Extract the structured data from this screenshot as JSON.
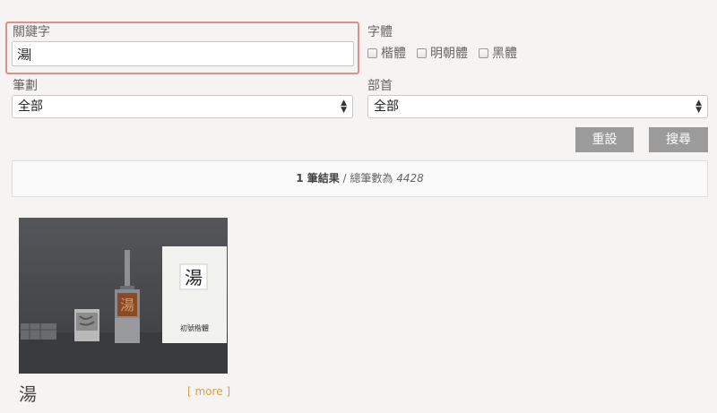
{
  "search": {
    "keyword_label": "關鍵字",
    "keyword_value": "湯",
    "font_label": "字體",
    "font_options": [
      "楷體",
      "明朝體",
      "黑體"
    ],
    "stroke_label": "筆劃",
    "stroke_value": "全部",
    "radical_label": "部首",
    "radical_value": "全部",
    "reset_label": "重設",
    "search_label": "搜尋"
  },
  "results": {
    "count_text": "1 筆結果",
    "separator": " / 總筆數為 ",
    "total": "4428"
  },
  "card": {
    "title": "湯",
    "more_label": "[ more ]",
    "image": {
      "card_char": "湯",
      "card_caption": "初號楷體",
      "type_char": "湯"
    }
  },
  "colors": {
    "background": "#f6f4f2",
    "highlight_border": "#df8e8e",
    "button_bg": "#9b9b9b",
    "more_link": "#d4a04a"
  }
}
